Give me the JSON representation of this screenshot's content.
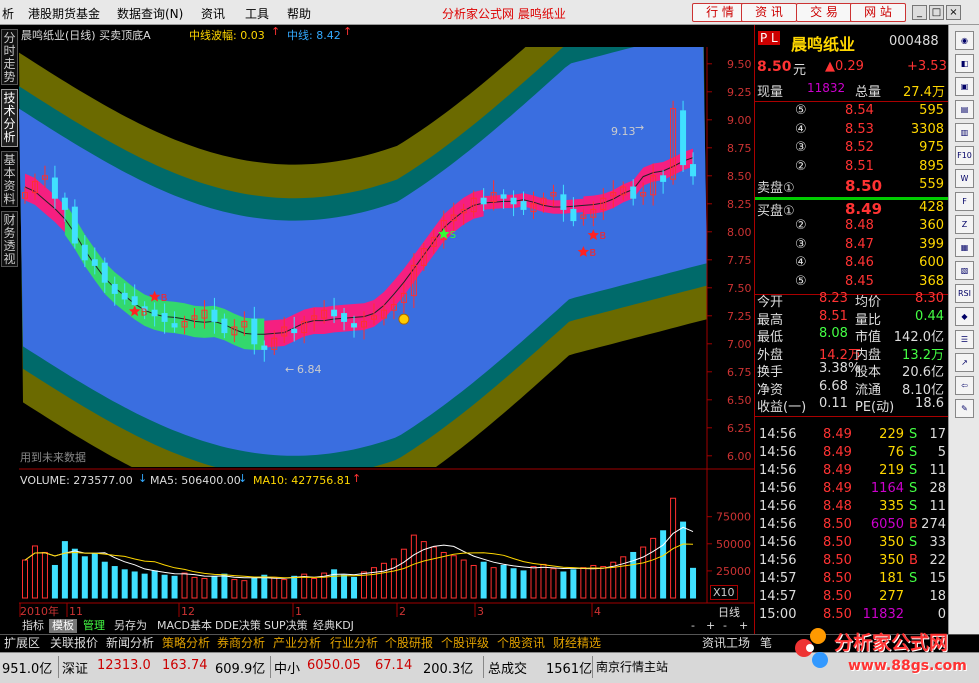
{
  "menu": {
    "items": [
      "析",
      "港股期货基金",
      "数据查询(N)",
      "资讯",
      "工具",
      "帮助"
    ],
    "center_title": "分析家公式网  晨鸣纸业",
    "top_buttons": [
      "行 情",
      "资 讯",
      "交 易",
      "网 站"
    ]
  },
  "left_tabs": [
    "分时走势",
    "技术分析",
    "基本资料",
    "财务透视"
  ],
  "chart": {
    "title": "晨鸣纸业(日线) 买卖顶底A",
    "ind1_label": "中线波幅: 0.03",
    "ind2_label": "中线: 8.42",
    "price_ticks": [
      "9.50",
      "9.25",
      "9.00",
      "8.75",
      "8.50",
      "8.25",
      "8.00",
      "7.75",
      "7.50",
      "7.25",
      "7.00",
      "6.75",
      "6.50",
      "6.25",
      "6.00"
    ],
    "high_label": "9.13",
    "low_label": "6.84",
    "s_label": "S",
    "b_label": "B",
    "future_note": "用到未来数据",
    "vol_label": "VOLUME: 273577.00",
    "ma5_label": "MA5: 506400.00",
    "ma10_label": "MA10: 427756.81",
    "vol_ticks": [
      "75000",
      "50000",
      "25000"
    ],
    "vol_unit": "X10",
    "date_labels": [
      "2010年",
      "11",
      "12",
      "1",
      "2",
      "3",
      "4"
    ],
    "period": "日线",
    "colors": {
      "outer_band": "#6b6a00",
      "mid_band": "#006a6a",
      "inner_band": "#3a6ee0",
      "pink_ribbon": "#ff1a7a",
      "green_ribbon": "#33dd66",
      "up_candle": "#ff3030",
      "down_candle": "#40e0ff",
      "axis": "#a00000"
    }
  },
  "chart_data": {
    "type": "candlestick",
    "title": "晨鸣纸业(日线) 买卖顶底A",
    "y_range": [
      5.9,
      9.65
    ],
    "volume_range": [
      0,
      95000
    ],
    "vol_unit": "X10",
    "closes": [
      8.35,
      8.45,
      8.5,
      8.3,
      8.2,
      7.9,
      7.75,
      7.7,
      7.55,
      7.45,
      7.4,
      7.35,
      7.3,
      7.25,
      7.2,
      7.15,
      7.2,
      7.25,
      7.3,
      7.2,
      7.1,
      7.15,
      7.2,
      7.0,
      6.95,
      7.05,
      7.15,
      7.1,
      7.2,
      7.25,
      7.3,
      7.25,
      7.2,
      7.15,
      7.2,
      7.25,
      7.3,
      7.35,
      7.45,
      7.7,
      7.85,
      7.95,
      8.1,
      8.15,
      8.2,
      8.3,
      8.25,
      8.35,
      8.3,
      8.25,
      8.2,
      8.25,
      8.3,
      8.35,
      8.2,
      8.1,
      8.15,
      8.2,
      8.3,
      8.35,
      8.4,
      8.3,
      8.35,
      8.5,
      8.45,
      9.1,
      8.6,
      8.5
    ],
    "volumes": [
      35000,
      48000,
      42000,
      30000,
      52000,
      45000,
      38000,
      41000,
      33000,
      29000,
      26000,
      24000,
      22000,
      25000,
      21000,
      20000,
      23000,
      19000,
      18000,
      20000,
      22000,
      17000,
      16000,
      18000,
      21000,
      19000,
      17000,
      20000,
      22000,
      18000,
      23000,
      26000,
      21000,
      19000,
      24000,
      28000,
      32000,
      36000,
      45000,
      58000,
      52000,
      47000,
      42000,
      39000,
      35000,
      30000,
      33000,
      28000,
      30000,
      27000,
      25000,
      29000,
      31000,
      27000,
      24000,
      26000,
      28000,
      30000,
      29000,
      33000,
      38000,
      42000,
      47000,
      55000,
      62000,
      92000,
      70000,
      27358
    ],
    "ma5_volume": 506400.0,
    "ma10_volume": 427756.81,
    "annotations": {
      "high": 9.13,
      "low": 6.84
    },
    "dates": [
      "2010年",
      "11",
      "12",
      "1",
      "2",
      "3",
      "4"
    ]
  },
  "quote": {
    "pl": "P L",
    "name": "晨鸣纸业",
    "code": "000488",
    "price": "8.50",
    "price_unit": "元",
    "change": "▲0.29",
    "pct": "+3.53",
    "xianliang_label": "现量",
    "xianliang": "11832",
    "zongliang_label": "总量",
    "zongliang": "27.4万",
    "sell": [
      {
        "lvl": "⑤",
        "price": "8.54",
        "vol": "595"
      },
      {
        "lvl": "④",
        "price": "8.53",
        "vol": "3308"
      },
      {
        "lvl": "③",
        "price": "8.52",
        "vol": "975"
      },
      {
        "lvl": "②",
        "price": "8.51",
        "vol": "895"
      },
      {
        "lvl": "卖盘①",
        "price": "8.50",
        "vol": "559"
      }
    ],
    "buy": [
      {
        "lvl": "买盘①",
        "price": "8.49",
        "vol": "428"
      },
      {
        "lvl": "②",
        "price": "8.48",
        "vol": "360"
      },
      {
        "lvl": "③",
        "price": "8.47",
        "vol": "399"
      },
      {
        "lvl": "④",
        "price": "8.46",
        "vol": "600"
      },
      {
        "lvl": "⑤",
        "price": "8.45",
        "vol": "368"
      }
    ],
    "stats": [
      {
        "l1": "今开",
        "v1": "8.23",
        "l2": "均价",
        "v2": "8.30"
      },
      {
        "l1": "最高",
        "v1": "8.51",
        "l2": "量比",
        "v2": "0.44"
      },
      {
        "l1": "最低",
        "v1": "8.08",
        "l2": "市值",
        "v2": "142.0亿"
      },
      {
        "l1": "外盘",
        "v1": "14.2万",
        "l2": "内盘",
        "v2": "13.2万"
      },
      {
        "l1": "换手",
        "v1": "3.38%",
        "l2": "股本",
        "v2": "20.6亿"
      },
      {
        "l1": "净资",
        "v1": "6.68",
        "l2": "流通",
        "v2": "8.10亿"
      },
      {
        "l1": "收益(一)",
        "v1": "0.11",
        "l2": "PE(动)",
        "v2": "18.6"
      }
    ],
    "ticks": [
      {
        "t": "14:56",
        "p": "8.49",
        "v": "229",
        "s": "S",
        "n": "17"
      },
      {
        "t": "14:56",
        "p": "8.49",
        "v": "76",
        "s": "S",
        "n": "5"
      },
      {
        "t": "14:56",
        "p": "8.49",
        "v": "219",
        "s": "S",
        "n": "11"
      },
      {
        "t": "14:56",
        "p": "8.49",
        "v": "1164",
        "s": "S",
        "n": "28"
      },
      {
        "t": "14:56",
        "p": "8.48",
        "v": "335",
        "s": "S",
        "n": "11"
      },
      {
        "t": "14:56",
        "p": "8.50",
        "v": "6050",
        "s": "B",
        "n": "274"
      },
      {
        "t": "14:56",
        "p": "8.50",
        "v": "350",
        "s": "S",
        "n": "33"
      },
      {
        "t": "14:56",
        "p": "8.50",
        "v": "350",
        "s": "B",
        "n": "22"
      },
      {
        "t": "14:57",
        "p": "8.50",
        "v": "181",
        "s": "S",
        "n": "15"
      },
      {
        "t": "14:57",
        "p": "8.50",
        "v": "277",
        "s": "",
        "n": "18"
      },
      {
        "t": "15:00",
        "p": "8.50",
        "v": "11832",
        "s": "",
        "n": "0"
      }
    ]
  },
  "tabrow1": [
    "指标",
    "模板",
    "管理",
    "另存为",
    "MACD基本",
    "DDE决策",
    "SUP决策",
    "经典KDJ"
  ],
  "tabrow1_right": [
    "-",
    "+",
    "-",
    "+"
  ],
  "tabrow2": [
    "扩展区",
    "关联报价",
    "新闻分析",
    "策略分析",
    "券商分析",
    "产业分析",
    "行业分析",
    "个股研报",
    "个股评级",
    "个股资讯",
    "财经精选"
  ],
  "tabrow2_right": [
    "资讯工场",
    "笔"
  ],
  "status": {
    "s1": "951.0亿",
    "shenzheng_label": "深证",
    "shenzheng": "12313.0",
    "s_chg": "163.74",
    "s_amt": "609.9亿",
    "zx_label": "中小",
    "zx": "6050.05",
    "zx_chg": "67.14",
    "zx_amt": "200.3亿",
    "total_label": "总成交",
    "total": "1561亿",
    "server": "南京行情主站"
  },
  "watermark": {
    "line1": "分析家公式网",
    "line2": "www.88gs.com"
  },
  "iconbar": [
    "◉",
    "◧",
    "▣",
    "▤",
    "▥",
    "F10",
    "W",
    "F",
    "Z",
    "▦",
    "▧",
    "RSI",
    "◆",
    "☰",
    "↗",
    "⇦",
    "✎"
  ]
}
